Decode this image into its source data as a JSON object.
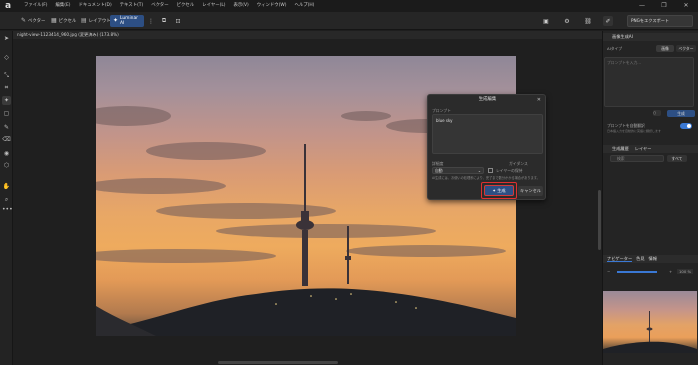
{
  "app": {
    "logo": "a"
  },
  "menu": [
    "ファイル(F)",
    "編集(E)",
    "ドキュメント(D)",
    "テキスト(T)",
    "ベクター",
    "ピクセル",
    "レイヤー(L)",
    "表示(V)",
    "ウィンドウ(W)",
    "ヘルプ(H)"
  ],
  "window_controls": {
    "minimize": "—",
    "maximize": "❐",
    "close": "✕"
  },
  "toolbar": {
    "vector": "ベクター",
    "pixel": "ピクセル",
    "layout": "レイアウト",
    "luminar": "Luminar AI",
    "more": "⋮",
    "export_label": "PNGをエクスポート"
  },
  "file_tab": "night-view-1123414_960.jpg (変更済み) (173.8%)",
  "dialog": {
    "title": "生成編集",
    "close": "✕",
    "prompt_label": "プロンプト",
    "prompt_value": "blue sky",
    "detail_label": "詳細度",
    "detail_value": "自動",
    "guidance_label": "ガイダンス",
    "check_label": "レイヤーの保持",
    "note": "AI生成には、お使いの処理系により、完了まで数分かかる場合があります。",
    "generate": "生成",
    "cancel": "キャンセル"
  },
  "right_panel": {
    "header1": "画像生成AI",
    "prompt_type_label": "AIタイプ",
    "tab_gen": "画像",
    "tab_vec": "ベクター",
    "prompt_placeholder": "プロンプトを入力...",
    "gen_small": "生成",
    "toggle_label": "プロンプトを自動翻訳",
    "toggle_sub": "日本語入力を自動的に英語に翻訳します",
    "header2": "生成履歴",
    "tab_layers": "レイヤー",
    "search_placeholder": "検索",
    "filter": "すべて",
    "nav_label": "ナビゲーター",
    "nav_tab2": "色見",
    "nav_tab3": "情報",
    "zoom": "100 %"
  },
  "colors": {
    "accent": "#2d4f84",
    "highlight": "#e03030"
  }
}
